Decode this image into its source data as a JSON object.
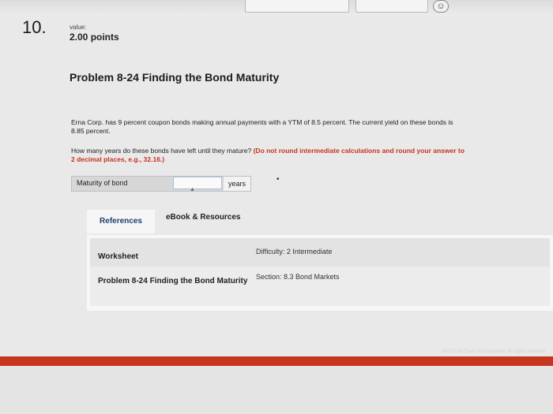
{
  "question": {
    "number": "10.",
    "value_label": "value:",
    "points": "2.00 points"
  },
  "problem": {
    "title": "Problem 8-24 Finding the Bond Maturity",
    "text": "Erna Corp. has 9 percent coupon bonds making annual payments with a YTM of 8.5 percent. The current yield on these bonds is 8.85 percent.",
    "question_text": "How many years do these bonds have left until they mature?",
    "instruction": "(Do not round intermediate calculations and round your answer to 2 decimal places, e.g., 32.16.)"
  },
  "answer": {
    "label": "Maturity of bond",
    "value": "",
    "unit": "years"
  },
  "tabs": [
    {
      "label": "References"
    },
    {
      "label": "eBook & Resources"
    }
  ],
  "references": {
    "row1": {
      "label": "Worksheet",
      "meta": "Difficulty: 2 Intermediate"
    },
    "row2": {
      "label": "Problem 8-24 Finding the Bond Maturity",
      "meta": "Section: 8.3 Bond Markets"
    }
  },
  "footer": {
    "copyright": "©2019 McGraw-Hill Education. All rights reserved."
  },
  "colors": {
    "accent": "#c7341f",
    "instruction": "#c8321e",
    "tab_active": "#1f3e6b"
  }
}
